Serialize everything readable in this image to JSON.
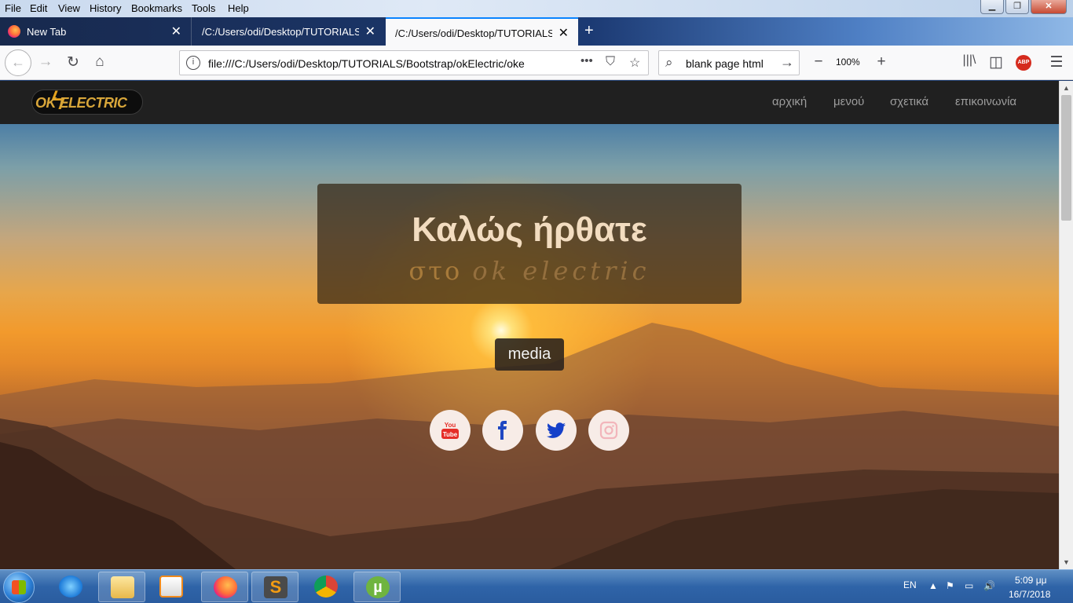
{
  "menubar": {
    "items": [
      "File",
      "Edit",
      "View",
      "History",
      "Bookmarks",
      "Tools",
      "Help"
    ]
  },
  "tabs": [
    {
      "title": "New Tab",
      "active": false
    },
    {
      "title": "/C:/Users/odi/Desktop/TUTORIALS/",
      "active": false
    },
    {
      "title": "/C:/Users/odi/Desktop/TUTORIALS/",
      "active": true
    }
  ],
  "navbar": {
    "url": "file:///C:/Users/odi/Desktop/TUTORIALS/Bootstrap/okElectric/oke",
    "search_text": "blank page html",
    "zoom": "100%",
    "page_actions": "•••",
    "abp_label": "ABP"
  },
  "site": {
    "logo_text": "OK ELECTRIC",
    "nav": [
      "αρχική",
      "μενού",
      "σχετικά",
      "επικοινωνία"
    ],
    "hero_title": "Καλώς ήρθατε",
    "hero_sub_prefix": "στο",
    "hero_sub_brand": "ok electric",
    "media_label": "media",
    "social": [
      {
        "name": "youtube",
        "color": "#e52d27"
      },
      {
        "name": "facebook",
        "color": "#1f47c2"
      },
      {
        "name": "twitter",
        "color": "#1540c9"
      },
      {
        "name": "instagram",
        "color": "#f2b5bb"
      }
    ]
  },
  "taskbar": {
    "lang": "EN",
    "time": "5:09 μμ",
    "date": "16/7/2018"
  },
  "colors": {
    "firefox_active_tab_accent": "#0a84ff",
    "site_nav_bg": "#202020"
  }
}
